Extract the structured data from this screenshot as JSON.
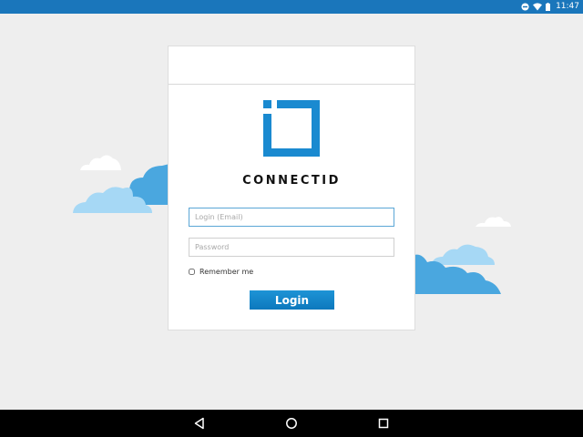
{
  "status_bar": {
    "time": "11:47",
    "icons": [
      "do-not-disturb-icon",
      "wifi-icon",
      "battery-icon"
    ]
  },
  "login_card": {
    "brand_name": "CONNECTID",
    "login_placeholder": "Login (Email)",
    "login_value": "",
    "password_placeholder": "Password",
    "password_value": "",
    "remember_label": "Remember me",
    "remember_checked": false,
    "login_button_label": "Login"
  },
  "nav_bar": {
    "buttons": [
      "back-icon",
      "home-icon",
      "recents-icon"
    ]
  },
  "colors": {
    "status_bar": "#1a76bb",
    "accent": "#1a8ad0",
    "background": "#eeeeee",
    "cloud_light": "#a6d8f5",
    "cloud_dark": "#4aa7df"
  }
}
